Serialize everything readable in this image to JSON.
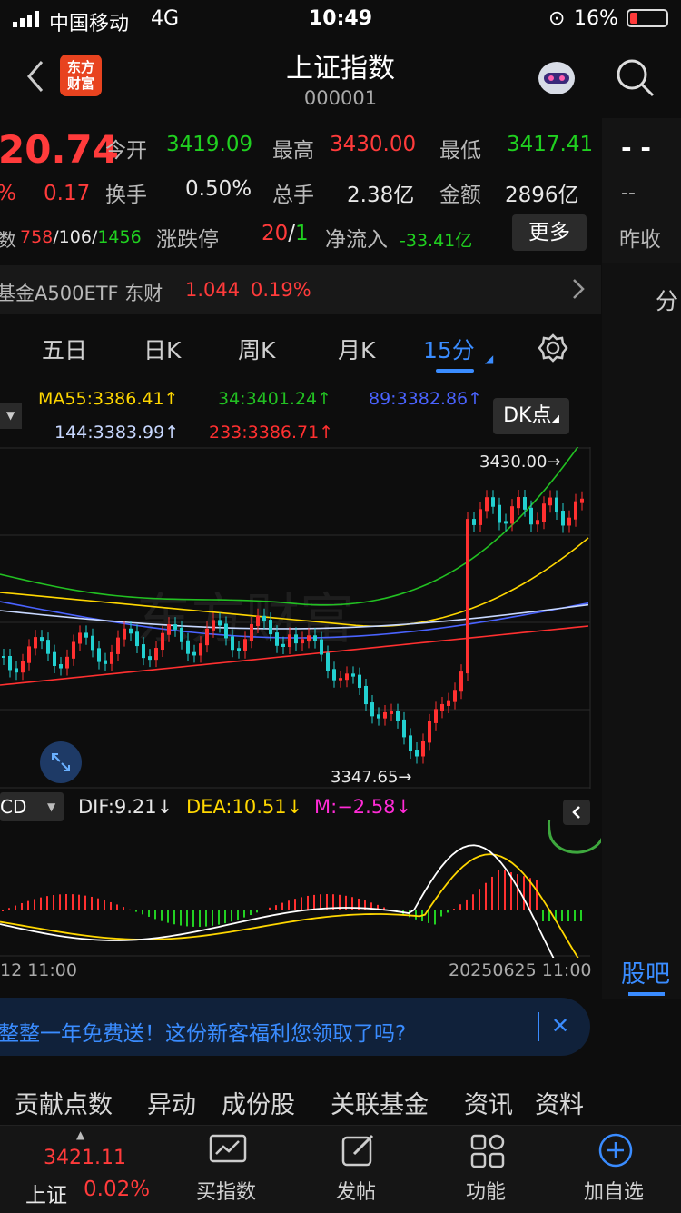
{
  "status": {
    "carrier": "中国移动",
    "network": "4G",
    "time": "10:49",
    "battery": "16%"
  },
  "header": {
    "title": "上证指数",
    "code": "000001",
    "logo_text": "东方财富"
  },
  "quote": {
    "price": "20.74",
    "pct_fragment": "%",
    "change": "0.17",
    "open_label": "今开",
    "open": "3419.09",
    "high_label": "最高",
    "high": "3430.00",
    "low_label": "最低",
    "low": "3417.41",
    "turnover_label": "换手",
    "turnover": "0.50%",
    "volume_label": "总手",
    "volume": "2.38亿",
    "amount_label": "金额",
    "amount": "2896亿",
    "count_prefix": "数",
    "up_count": "758",
    "flat_count": "/106/",
    "down_count": "1456",
    "limit_label": "涨跌停",
    "limit_up": "20",
    "limit_sep": "/",
    "limit_down": "1",
    "netflow_label": "净流入",
    "netflow": "-33.41亿",
    "more_label": "更多",
    "side_dash1": "- -",
    "side_dash2": "--",
    "side_prev_label": "昨收"
  },
  "etf": {
    "prefix": "基金",
    "name": "A500ETF 东财",
    "price": "1.044",
    "pct": "0.19%"
  },
  "tabs": [
    {
      "label": "五日"
    },
    {
      "label": "日K"
    },
    {
      "label": "周K"
    },
    {
      "label": "月K"
    },
    {
      "label": "15分"
    }
  ],
  "side": {
    "fen": "分",
    "guba": "股吧"
  },
  "ma": {
    "ma55": "MA55:3386.41↑",
    "ma34": "34:3401.24↑",
    "ma89": "89:3382.86↑",
    "ma144": "144:3383.99↑",
    "ma233": "233:3386.71↑",
    "dk_label": "DK点",
    "colors": {
      "ma55": "#ffd700",
      "ma34": "#22c022",
      "ma89": "#4a63ff",
      "ma144": "#c8d8ff",
      "ma233": "#ff3030"
    }
  },
  "chart_data": {
    "type": "candlestick",
    "interval": "15分",
    "high_mark": "3430.00→",
    "low_mark": "3347.65→",
    "high": 3430.0,
    "low": 3347.65,
    "date_left": "12 11:00",
    "date_right": "20250625 11:00",
    "macd": {
      "box_label": "CD",
      "dif": "DIF:9.21↓",
      "dea": "DEA:10.51↓",
      "m": "M:−2.58↓"
    }
  },
  "promo": {
    "text": "整整一年免费送！这份新客福利您领取了吗?",
    "close": "✕"
  },
  "subtabs": [
    "贡献点数",
    "异动",
    "成份股",
    "关联基金",
    "资讯",
    "资料"
  ],
  "bottom": {
    "index_price": "3421.11",
    "index_name": "上证",
    "index_pct": "0.02%",
    "nav": [
      {
        "label": "买指数"
      },
      {
        "label": "发帖"
      },
      {
        "label": "功能"
      },
      {
        "label": "加自选"
      }
    ]
  }
}
